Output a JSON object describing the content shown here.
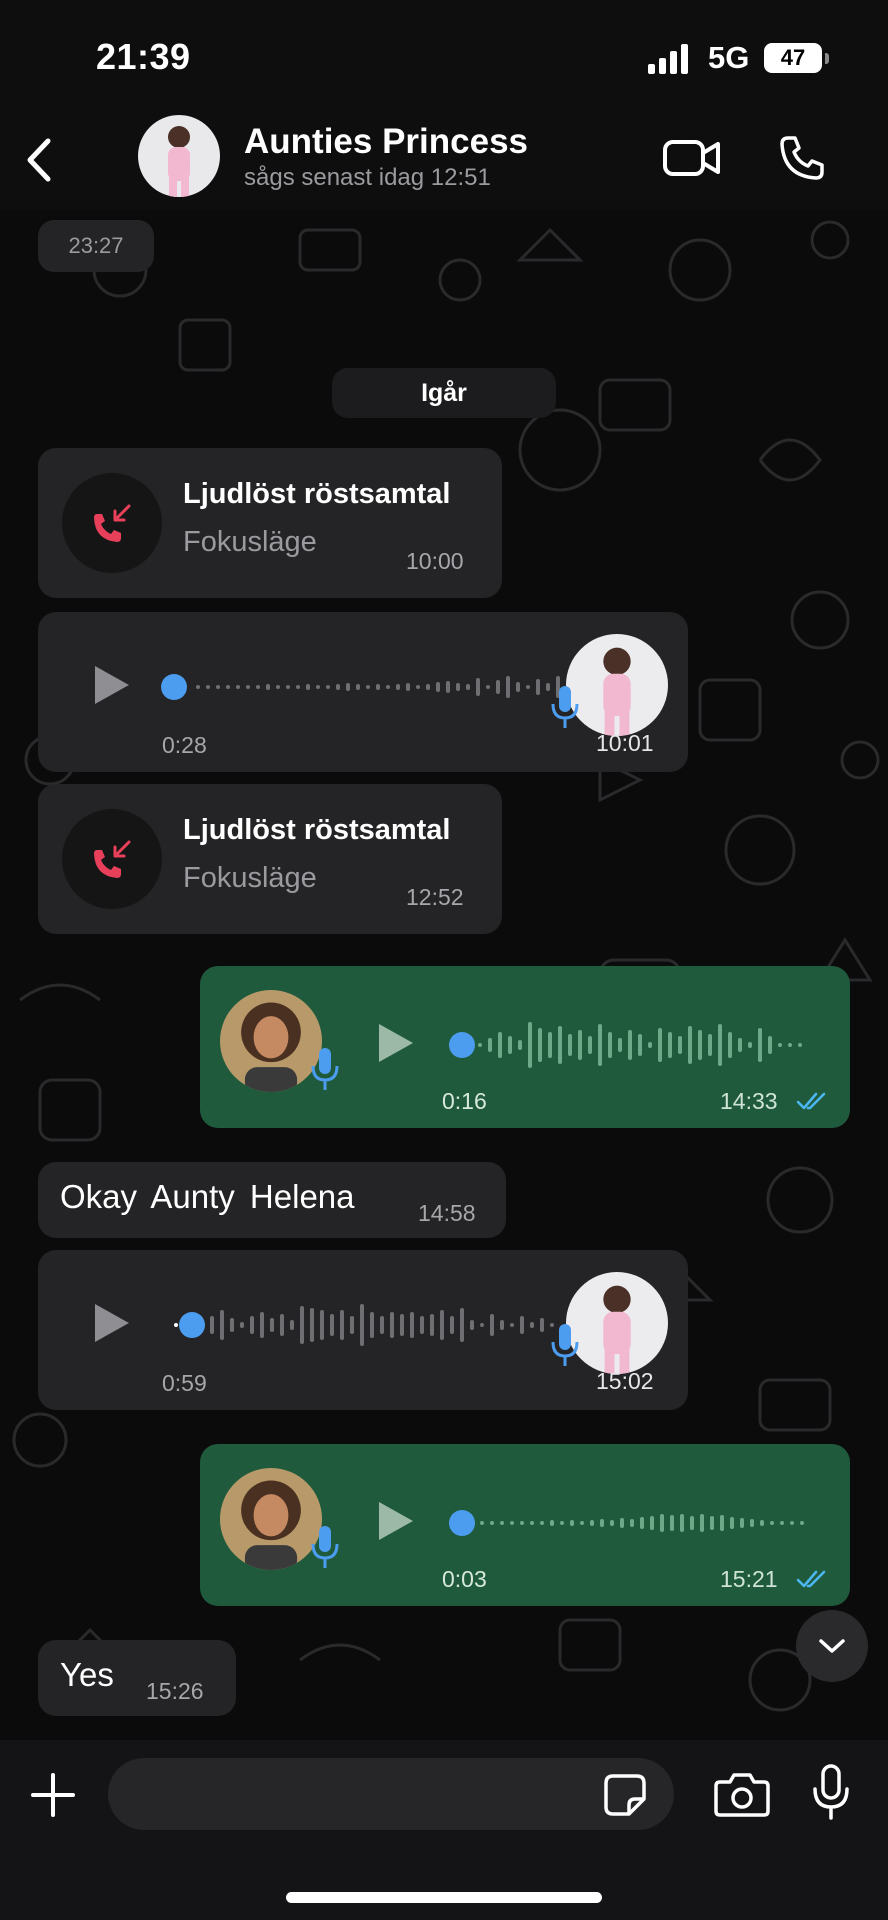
{
  "status_bar": {
    "time": "21:39",
    "network": "5G",
    "battery": "47"
  },
  "header": {
    "contact_name": "Aunties Princess",
    "last_seen": "sågs senast idag 12:51"
  },
  "chat": {
    "top_time": "23:27",
    "date_separator": "Igår",
    "messages": [
      {
        "type": "call",
        "direction": "in",
        "title": "Ljudlöst röstsamtal",
        "subtitle": "Fokusläge",
        "time": "10:00"
      },
      {
        "type": "voice",
        "direction": "in",
        "duration": "0:28",
        "time": "10:01"
      },
      {
        "type": "call",
        "direction": "in",
        "title": "Ljudlöst röstsamtal",
        "subtitle": "Fokusläge",
        "time": "12:52"
      },
      {
        "type": "voice",
        "direction": "out",
        "duration": "0:16",
        "time": "14:33",
        "status": "read"
      },
      {
        "type": "text",
        "direction": "in",
        "text": "Okay  Aunty  Helena",
        "time": "14:58"
      },
      {
        "type": "voice",
        "direction": "in",
        "duration": "0:59",
        "time": "15:02"
      },
      {
        "type": "voice",
        "direction": "out",
        "duration": "0:03",
        "time": "15:21",
        "status": "read"
      },
      {
        "type": "text",
        "direction": "in",
        "text": "Yes",
        "time": "15:26"
      }
    ]
  },
  "composer": {
    "placeholder": ""
  },
  "icons": {
    "back": "chevron-left-icon",
    "video": "video-camera-icon",
    "call": "phone-icon",
    "missed_call": "missed-call-icon",
    "play": "play-icon",
    "mic": "microphone-icon",
    "read": "double-check-icon",
    "scroll": "chevron-down-icon",
    "attach": "plus-icon",
    "sticker": "sticker-icon",
    "camera": "camera-icon"
  },
  "colors": {
    "incoming_bubble": "#242426",
    "outgoing_bubble": "#1f5a3d",
    "accent_blue": "#4c9df0",
    "missed_call_red": "#e8405a",
    "background": "#0b0b0c"
  }
}
